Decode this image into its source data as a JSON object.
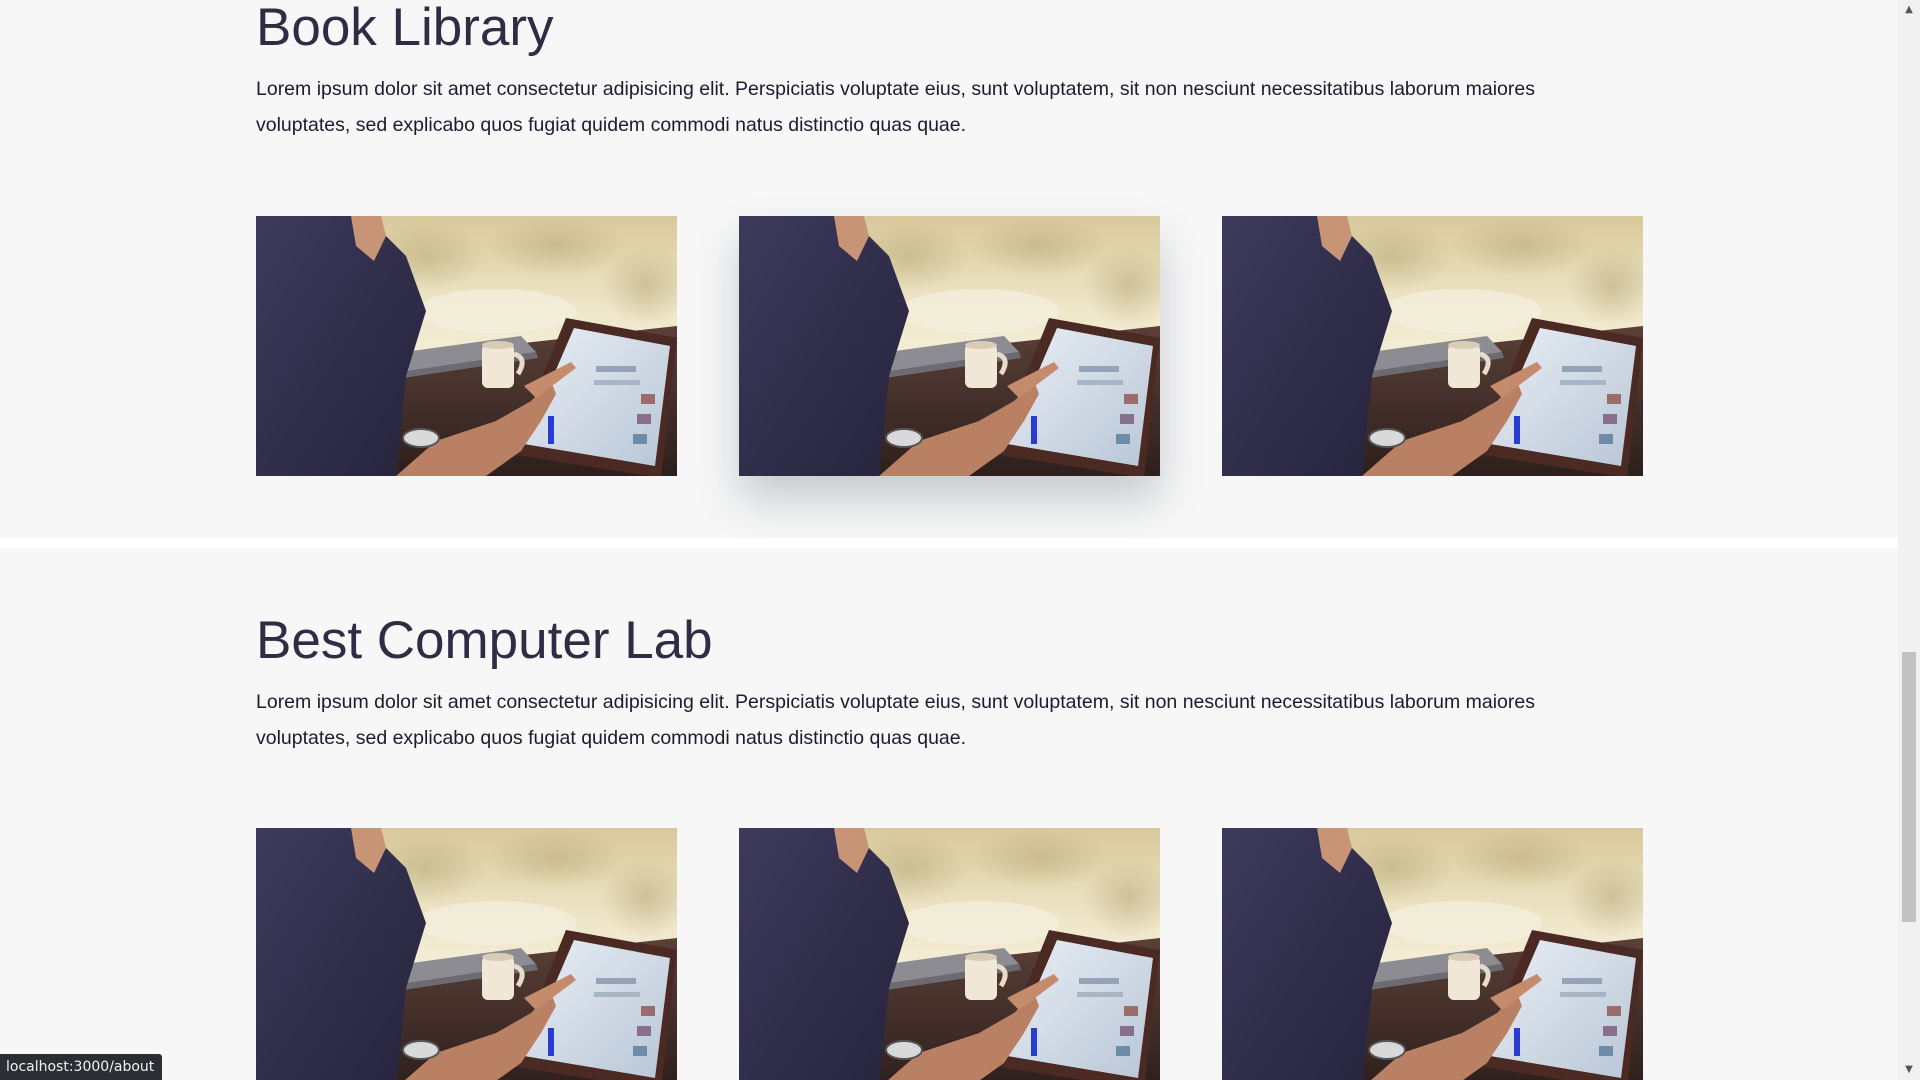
{
  "sections": [
    {
      "title": "Book Library",
      "description": "Lorem ipsum dolor sit amet consectetur adipisicing elit. Perspiciatis voluptate eius, sunt voluptatem, sit non nesciunt necessitatibus laborum maiores voluptates, sed explicabo quos fugiat quidem commodi natus distinctio quas quae.",
      "images": [
        {
          "subject": "man using tablet at table with coffee mug"
        },
        {
          "subject": "man using tablet at table with coffee mug",
          "state": "hovered"
        },
        {
          "subject": "man using tablet at table with coffee mug"
        }
      ]
    },
    {
      "title": "Best Computer Lab",
      "description": "Lorem ipsum dolor sit amet consectetur adipisicing elit. Perspiciatis voluptate eius, sunt voluptatem, sit non nesciunt necessitatibus laborum maiores voluptates, sed explicabo quos fugiat quidem commodi natus distinctio quas quae.",
      "images": [
        {
          "subject": "man using tablet at table with coffee mug"
        },
        {
          "subject": "man using tablet at table with coffee mug"
        },
        {
          "subject": "man using tablet at table with coffee mug"
        }
      ]
    }
  ],
  "status_bar": {
    "url": "localhost:3000/about"
  },
  "scrollbar": {
    "scroll_position": 0.62,
    "up_arrow_icon": "triangle-up-icon",
    "down_arrow_icon": "triangle-down-icon"
  },
  "colors": {
    "page_background": "#f7f7f7",
    "heading_text": "#2f2c44",
    "body_text": "#1d1b2e",
    "status_bar_background": "#2b2f33"
  }
}
